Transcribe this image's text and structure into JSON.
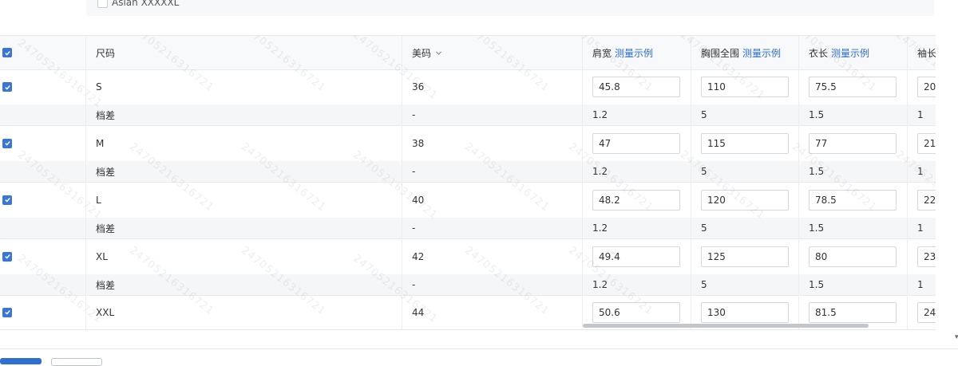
{
  "top_option": {
    "label": "Asian XXXXXL"
  },
  "header": {
    "size_label": "尺码",
    "us_label": "美码",
    "columns": [
      {
        "label": "肩宽",
        "link": "测量示例"
      },
      {
        "label": "胸围全围",
        "link": "测量示例"
      },
      {
        "label": "衣长",
        "link": "测量示例"
      },
      {
        "label": "袖长",
        "link": ""
      }
    ]
  },
  "rows": [
    {
      "size": "S",
      "us": "36",
      "values": [
        "45.8",
        "110",
        "75.5",
        "20"
      ]
    },
    {
      "size": "档差",
      "us": "-",
      "values": [
        "1.2",
        "5",
        "1.5",
        "1"
      ]
    },
    {
      "size": "M",
      "us": "38",
      "values": [
        "47",
        "115",
        "77",
        "21"
      ]
    },
    {
      "size": "档差",
      "us": "-",
      "values": [
        "1.2",
        "5",
        "1.5",
        "1"
      ]
    },
    {
      "size": "L",
      "us": "40",
      "values": [
        "48.2",
        "120",
        "78.5",
        "22"
      ]
    },
    {
      "size": "档差",
      "us": "-",
      "values": [
        "1.2",
        "5",
        "1.5",
        "1"
      ]
    },
    {
      "size": "XL",
      "us": "42",
      "values": [
        "49.4",
        "125",
        "80",
        "23"
      ]
    },
    {
      "size": "档差",
      "us": "-",
      "values": [
        "1.2",
        "5",
        "1.5",
        "1"
      ]
    },
    {
      "size": "XXL",
      "us": "44",
      "values": [
        "50.6",
        "130",
        "81.5",
        "24"
      ]
    }
  ],
  "watermark_text": "24705216316721",
  "colors": {
    "accent": "#3a76d6",
    "link": "#2c6cc9",
    "header_bg": "#f8f9fb"
  }
}
